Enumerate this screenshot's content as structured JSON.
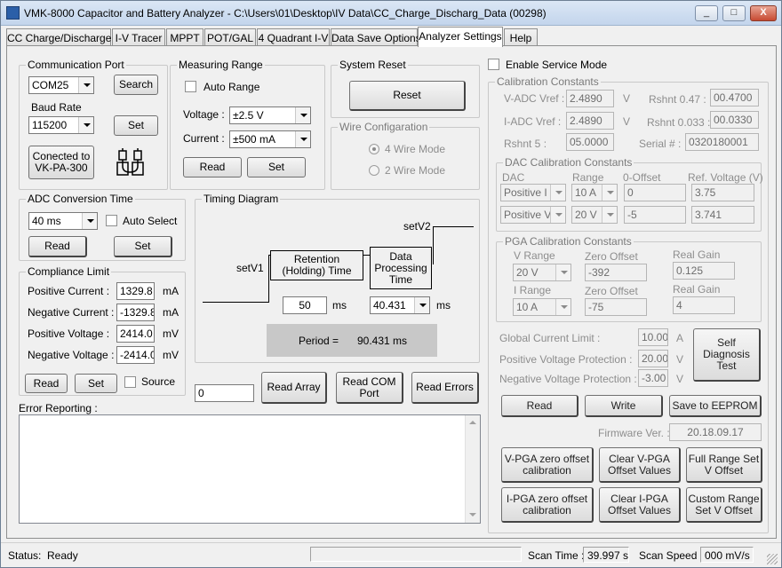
{
  "window": {
    "title": "VMK-8000 Capacitor and Battery Analyzer - C:\\Users\\01\\Desktop\\IV Data\\CC_Charge_Discharg_Data (00298)",
    "min": "_",
    "max": "□",
    "close": "X"
  },
  "tabs": [
    "CC Charge/Discharge",
    "I-V Tracer",
    "MPPT",
    "POT/GAL",
    "4 Quadrant I-V",
    "Data Save Options",
    "Analyzer Settings",
    "Help"
  ],
  "comm": {
    "title": "Communication Port",
    "port": "COM25",
    "search": "Search",
    "baud_label": "Baud Rate",
    "baud": "115200",
    "set": "Set",
    "connected": "Conected to VK-PA-300"
  },
  "measuring": {
    "title": "Measuring Range",
    "auto": "Auto Range",
    "voltage_label": "Voltage :",
    "voltage": "±2.5 V",
    "current_label": "Current :",
    "current": "±500 mA",
    "read": "Read",
    "set": "Set"
  },
  "reset": {
    "title": "System Reset",
    "button": "Reset"
  },
  "wire": {
    "title": "Wire Configaration",
    "opt4": "4 Wire Mode",
    "opt2": "2 Wire Mode"
  },
  "adc": {
    "title": "ADC Conversion Time",
    "value": "40 ms",
    "auto": "Auto Select",
    "read": "Read",
    "set": "Set"
  },
  "compliance": {
    "title": "Compliance Limit",
    "rows": [
      {
        "label": "Positive Current :",
        "value": "1329.8",
        "unit": "mA"
      },
      {
        "label": "Negative Current :",
        "value": "-1329.8",
        "unit": "mA"
      },
      {
        "label": "Positive Voltage :",
        "value": "2414.0",
        "unit": "mV"
      },
      {
        "label": "Negative Voltage :",
        "value": "-2414.0",
        "unit": "mV"
      }
    ],
    "read": "Read",
    "set": "Set",
    "source": "Source"
  },
  "timing": {
    "title": "Timing Diagram",
    "setv1": "setV1",
    "setv2": "setV2",
    "retention": "Retention (Holding) Time",
    "processing": "Data Processing Time",
    "ret_value": "50",
    "unit1": "ms",
    "proc_value": "40.431",
    "unit2": "ms",
    "period_label": "Period =",
    "period_value": "90.431",
    "period_unit": "ms"
  },
  "array": {
    "value": "0",
    "read_array": "Read Array",
    "read_com": "Read COM Port",
    "read_errors": "Read Errors"
  },
  "errors": {
    "title": "Error Reporting :"
  },
  "service": {
    "enable": "Enable Service Mode"
  },
  "calib": {
    "title": "Calibration Constants",
    "vadc_label": "V-ADC Vref :",
    "vadc": "2.4890",
    "vadc_unit": "V",
    "iadc_label": "I-ADC Vref :",
    "iadc": "2.4890",
    "iadc_unit": "V",
    "rshnt47_label": "Rshnt 0.47 :",
    "rshnt47": "00.4700",
    "rshnt033_label": "Rshnt 0.033 :",
    "rshnt033": "00.0330",
    "rshnt5_label": "Rshnt 5 :",
    "rshnt5": "05.0000",
    "serial_label": "Serial # :",
    "serial": "0320180001"
  },
  "dac": {
    "title": "DAC Calibration Constants",
    "h_dac": "DAC",
    "h_range": "Range",
    "h_offset": "0-Offset",
    "h_ref": "Ref. Voltage (V)",
    "rows": [
      {
        "dac": "Positive I",
        "range": "10 A",
        "offset": "0",
        "ref": "3.75"
      },
      {
        "dac": "Positive V",
        "range": "20 V",
        "offset": "-5",
        "ref": "3.741"
      }
    ]
  },
  "pga": {
    "title": "PGA Calibration Constants",
    "vrange_label": "V Range",
    "vrange": "20 V",
    "vzero_label": "Zero Offset",
    "vzero": "-392",
    "vgain_label": "Real Gain",
    "vgain": "0.125",
    "irange_label": "I Range",
    "irange": "10 A",
    "izero_label": "Zero Offset",
    "izero": "-75",
    "igain_label": "Real Gain",
    "igain": "4"
  },
  "limits": {
    "gcl_label": "Global Current Limit :",
    "gcl": "10.00",
    "gcl_unit": "A",
    "pvp_label": "Positive Voltage Protection :",
    "pvp": "20.00",
    "pvp_unit": "V",
    "nvp_label": "Negative Voltage Protection :",
    "nvp": "-3.00",
    "nvp_unit": "V",
    "self_diag": "Self Diagnosis Test"
  },
  "eeprom": {
    "read": "Read",
    "write": "Write",
    "save": "Save to EEPROM",
    "fw_label": "Firmware Ver. :",
    "fw": "20.18.09.17"
  },
  "offsets": {
    "vpga_zero": "V-PGA zero offset calibration",
    "clear_vpga": "Clear V-PGA Offset Values",
    "full_range": "Full Range Set V Offset",
    "ipga_zero": "I-PGA zero offset calibration",
    "clear_ipga": "Clear I-PGA Offset Values",
    "custom_range": "Custom Range Set V Offset"
  },
  "status": {
    "label": "Status:",
    "value": "Ready",
    "scan_time_label": "Scan Time :",
    "scan_time": "39.997 s",
    "scan_speed_label": "Scan Speed :",
    "scan_speed": "000 mV/s"
  }
}
